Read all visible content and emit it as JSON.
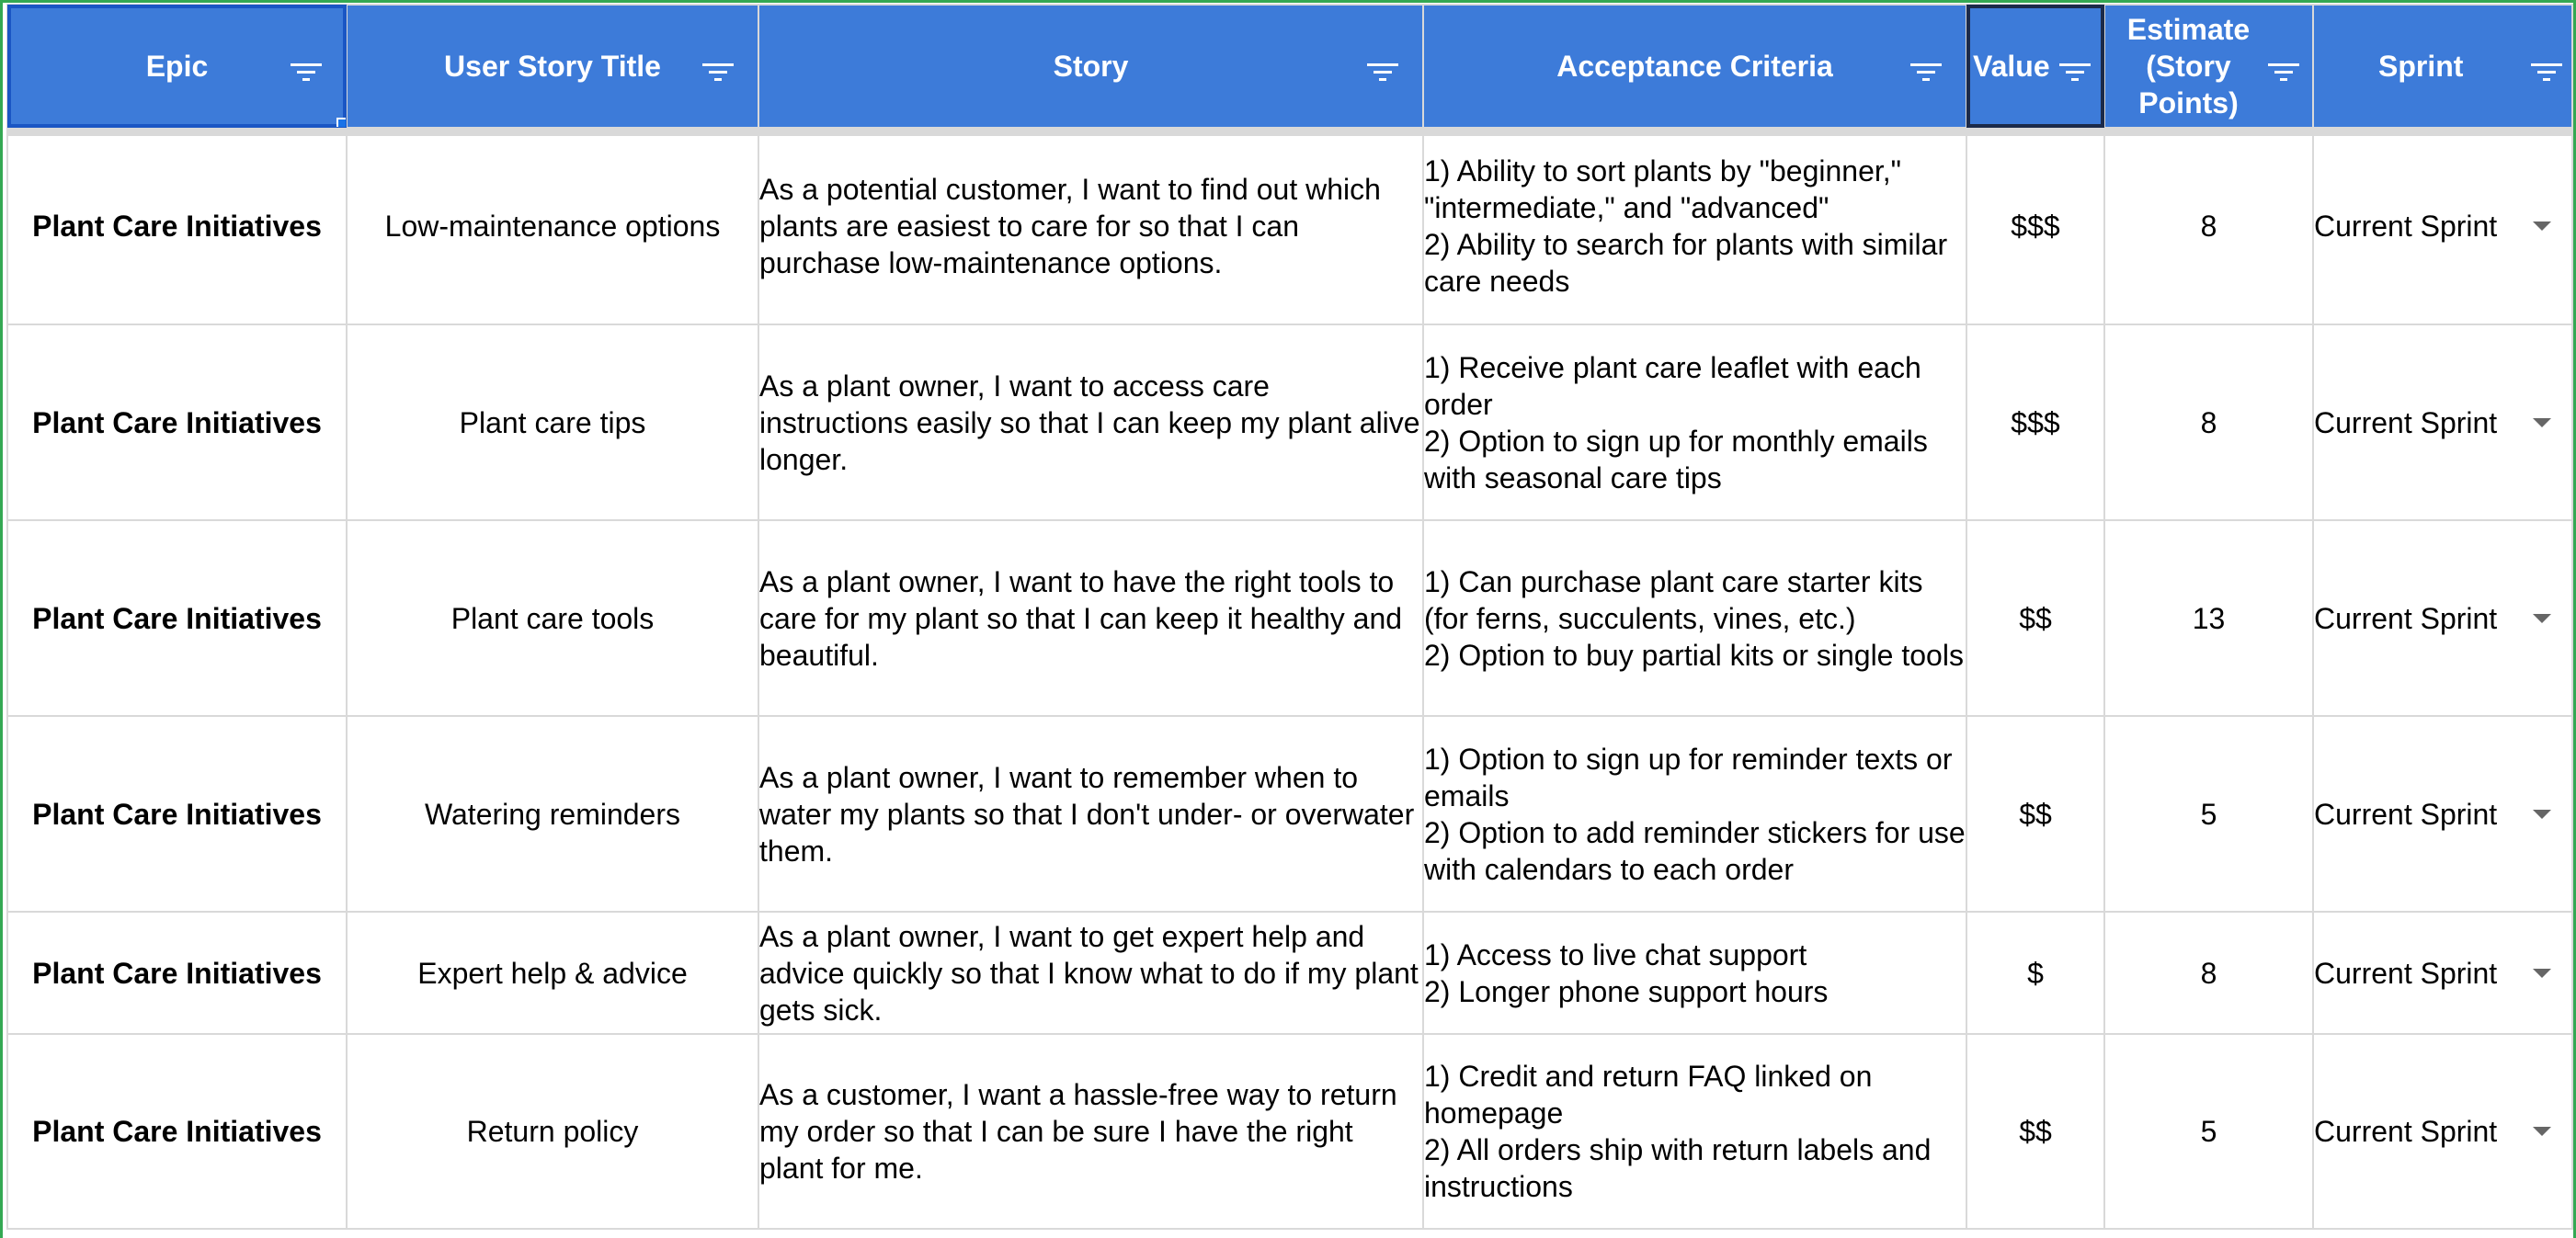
{
  "sheet": {
    "columns": [
      "Epic",
      "User Story Title",
      "Story",
      "Acceptance Criteria",
      "Value",
      "Estimate (Story Points)",
      "Sprint"
    ],
    "rows": [
      {
        "epic": "Plant Care Initiatives",
        "title": "Low-maintenance options",
        "story": "As a potential customer, I want to find out which plants are easiest to care for so that I can purchase low-maintenance options.",
        "criteria": [
          "1) Ability to sort plants by \"beginner,\" \"intermediate,\" and \"advanced\"",
          "2) Ability to search for plants with similar care needs"
        ],
        "value": "$$$",
        "estimate": "8",
        "sprint": "Current Sprint"
      },
      {
        "epic": "Plant Care Initiatives",
        "title": "Plant care tips",
        "story": "As a plant owner, I want to access care instructions easily so that I can keep my plant alive longer.",
        "criteria": [
          "1) Receive plant care leaflet with each order",
          "2) Option to sign up for monthly emails with seasonal care tips"
        ],
        "value": "$$$",
        "estimate": "8",
        "sprint": "Current Sprint"
      },
      {
        "epic": "Plant Care Initiatives",
        "title": "Plant care tools",
        "story": "As a plant owner, I want to have the right tools to care for my plant so that I can keep it healthy and beautiful.",
        "criteria": [
          "1) Can purchase plant care starter kits (for ferns, succulents, vines, etc.)",
          "2) Option to buy partial kits or single tools"
        ],
        "value": "$$",
        "estimate": "13",
        "sprint": "Current Sprint"
      },
      {
        "epic": "Plant Care Initiatives",
        "title": "Watering reminders",
        "story": "As a plant owner, I want to remember when to water my plants so that I don't under- or overwater them.",
        "criteria": [
          "1) Option to sign up for reminder texts or emails",
          "2) Option to add reminder stickers for use with calendars to each order"
        ],
        "value": "$$",
        "estimate": "5",
        "sprint": "Current Sprint"
      },
      {
        "epic": "Plant Care Initiatives",
        "title": "Expert help & advice",
        "story": "As a plant owner, I want to get expert help and advice quickly so that I know what to do if my plant gets sick.",
        "criteria": [
          "1) Access to live chat support",
          "2) Longer phone support hours"
        ],
        "value": "$",
        "estimate": "8",
        "sprint": "Current Sprint"
      },
      {
        "epic": "Plant Care Initiatives",
        "title": "Return policy",
        "story": "As a customer, I want a hassle-free way to return my order so that I can be sure I have the right plant for me.",
        "criteria": [
          "1) Credit and return FAQ linked on homepage",
          "2) All orders ship with return labels and instructions"
        ],
        "value": "$$",
        "estimate": "5",
        "sprint": "Current Sprint"
      }
    ]
  },
  "icons": {
    "header_filter": "filter-icon",
    "sprint_dropdown": "chevron-down-icon"
  },
  "colors": {
    "header_bg": "#3d7bd9",
    "header_text": "#ffffff",
    "gridline": "#d9d9d9",
    "selection": "#1a73e8",
    "sheet_edge": "#34a853"
  }
}
